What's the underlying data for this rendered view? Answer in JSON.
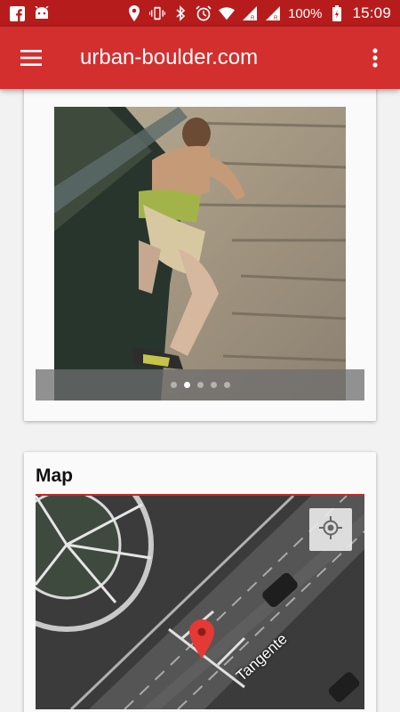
{
  "status_bar": {
    "left_icons": [
      "facebook-icon",
      "android-icon"
    ],
    "right_icons": [
      "location-icon",
      "vibrate-icon",
      "bluetooth-icon",
      "alarm-icon",
      "wifi-icon",
      "signal-icon",
      "signal-icon"
    ],
    "battery": "100%",
    "time": "15:09"
  },
  "app_bar": {
    "title": "urban-boulder.com",
    "menu_icon": "hamburger-menu-icon",
    "overflow_icon": "more-vert-icon",
    "color": "#d32f2f"
  },
  "gallery": {
    "page_count": 5,
    "active_page": 2
  },
  "map": {
    "title": "Map",
    "road_label": "Tangente",
    "locate_icon": "my-location-icon",
    "marker_icon": "map-pin-icon",
    "marker_color": "#e53935"
  }
}
